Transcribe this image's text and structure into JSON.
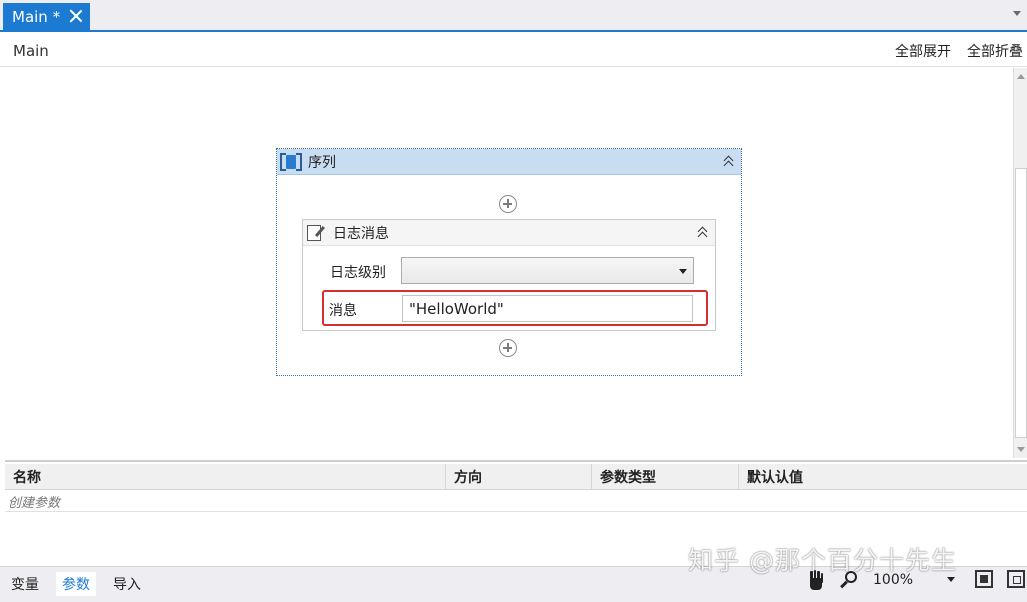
{
  "tab": {
    "label": "Main *"
  },
  "header": {
    "breadcrumb": "Main",
    "expand_all": "全部展开",
    "collapse_all": "全部折叠"
  },
  "sequence": {
    "title": "序列",
    "log_message": {
      "title": "日志消息",
      "level_label": "日志级别",
      "level_value": "",
      "message_label": "消息",
      "message_value": "\"HelloWorld\""
    }
  },
  "arguments": {
    "columns": [
      "名称",
      "方向",
      "参数类型",
      "默认认值"
    ],
    "create_placeholder": "创建参数"
  },
  "bottom": {
    "tabs": [
      {
        "label": "变量",
        "active": false
      },
      {
        "label": "参数",
        "active": true
      },
      {
        "label": "导入",
        "active": false
      }
    ],
    "zoom": "100%"
  },
  "watermark": "知乎 @那个百分十先生",
  "colors": {
    "accent": "#1c7ad1",
    "sequence_header": "#c8ddf2",
    "highlight": "#d32f2f"
  }
}
